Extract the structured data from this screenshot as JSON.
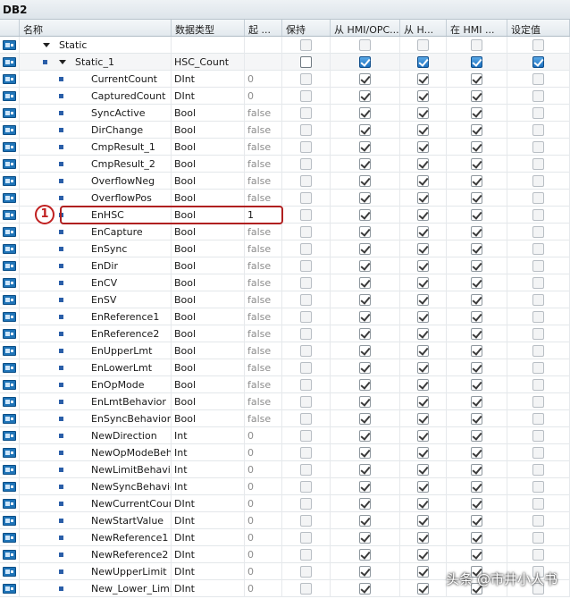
{
  "window": {
    "title": "DB2"
  },
  "headers": {
    "name": "名称",
    "type": "数据类型",
    "start": "起 ...",
    "retain": "保持",
    "hmi_opc": "从 HMI/OPC...",
    "hmi_h": "从 H...",
    "hmi_in": "在 HMI ...",
    "setpoint": "设定值"
  },
  "annotation": {
    "marker": "1"
  },
  "watermark": "头条 @市井小人书",
  "rows": [
    {
      "name": "Static",
      "type": "",
      "start": "",
      "level": 0,
      "expander": true,
      "group": true
    },
    {
      "name": "Static_1",
      "type": "HSC_Count",
      "start": "",
      "level": 1,
      "expander": true,
      "struct": true
    },
    {
      "name": "CurrentCount",
      "type": "DInt",
      "start": "0"
    },
    {
      "name": "CapturedCount",
      "type": "DInt",
      "start": "0"
    },
    {
      "name": "SyncActive",
      "type": "Bool",
      "start": "false"
    },
    {
      "name": "DirChange",
      "type": "Bool",
      "start": "false"
    },
    {
      "name": "CmpResult_1",
      "type": "Bool",
      "start": "false"
    },
    {
      "name": "CmpResult_2",
      "type": "Bool",
      "start": "false"
    },
    {
      "name": "OverflowNeg",
      "type": "Bool",
      "start": "false"
    },
    {
      "name": "OverflowPos",
      "type": "Bool",
      "start": "false"
    },
    {
      "name": "EnHSC",
      "type": "Bool",
      "start": "1",
      "edited": true
    },
    {
      "name": "EnCapture",
      "type": "Bool",
      "start": "false"
    },
    {
      "name": "EnSync",
      "type": "Bool",
      "start": "false"
    },
    {
      "name": "EnDir",
      "type": "Bool",
      "start": "false"
    },
    {
      "name": "EnCV",
      "type": "Bool",
      "start": "false"
    },
    {
      "name": "EnSV",
      "type": "Bool",
      "start": "false"
    },
    {
      "name": "EnReference1",
      "type": "Bool",
      "start": "false"
    },
    {
      "name": "EnReference2",
      "type": "Bool",
      "start": "false"
    },
    {
      "name": "EnUpperLmt",
      "type": "Bool",
      "start": "false"
    },
    {
      "name": "EnLowerLmt",
      "type": "Bool",
      "start": "false"
    },
    {
      "name": "EnOpMode",
      "type": "Bool",
      "start": "false"
    },
    {
      "name": "EnLmtBehavior",
      "type": "Bool",
      "start": "false"
    },
    {
      "name": "EnSyncBehavior",
      "type": "Bool",
      "start": "false"
    },
    {
      "name": "NewDirection",
      "type": "Int",
      "start": "0"
    },
    {
      "name": "NewOpModeBeha...",
      "type": "Int",
      "start": "0"
    },
    {
      "name": "NewLimitBehavior",
      "type": "Int",
      "start": "0"
    },
    {
      "name": "NewSyncBehavior",
      "type": "Int",
      "start": "0"
    },
    {
      "name": "NewCurrentCount",
      "type": "DInt",
      "start": "0"
    },
    {
      "name": "NewStartValue",
      "type": "DInt",
      "start": "0"
    },
    {
      "name": "NewReference1",
      "type": "DInt",
      "start": "0"
    },
    {
      "name": "NewReference2",
      "type": "DInt",
      "start": "0"
    },
    {
      "name": "NewUpperLimit",
      "type": "DInt",
      "start": "0"
    },
    {
      "name": "New_Lower_Limit",
      "type": "DInt",
      "start": "0"
    }
  ]
}
